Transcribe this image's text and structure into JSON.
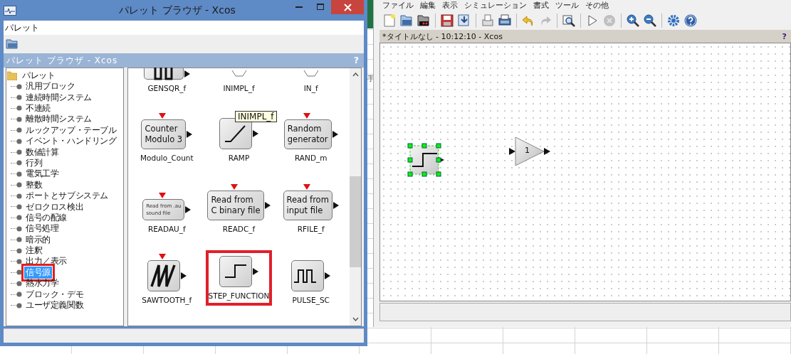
{
  "background_sheet": {
    "cell_text": "手"
  },
  "palette_window": {
    "title": "パレット ブラウザ - Xcos",
    "menu": [
      "パレット"
    ],
    "panel_title": "パレット ブラウザ - Xcos",
    "panel_help": "?",
    "tree": {
      "label": "パレット",
      "children": [
        {
          "label": "汎用ブロック",
          "selected": false
        },
        {
          "label": "連続時間システム",
          "selected": false
        },
        {
          "label": "不連続",
          "selected": false
        },
        {
          "label": "離散時間システム",
          "selected": false
        },
        {
          "label": "ルックアップ・テーブル",
          "selected": false
        },
        {
          "label": "イベント・ハンドリング",
          "selected": false
        },
        {
          "label": "数値計算",
          "selected": false
        },
        {
          "label": "行列",
          "selected": false
        },
        {
          "label": "電気工学",
          "selected": false
        },
        {
          "label": "整数",
          "selected": false
        },
        {
          "label": "ポートとサブシステム",
          "selected": false
        },
        {
          "label": "ゼロクロス検出",
          "selected": false
        },
        {
          "label": "信号の配線",
          "selected": false
        },
        {
          "label": "信号処理",
          "selected": false
        },
        {
          "label": "暗示的",
          "selected": false
        },
        {
          "label": "注釈",
          "selected": false
        },
        {
          "label": "出力／表示",
          "selected": false
        },
        {
          "label": "信号源",
          "selected": true
        },
        {
          "label": "熱水力学",
          "selected": false
        },
        {
          "label": "ブロック・デモ",
          "selected": false
        },
        {
          "label": "ユーザ定義関数",
          "selected": false
        }
      ]
    },
    "blocks": [
      {
        "name": "GENSQR_f",
        "kind": "squarewave",
        "event_input": false,
        "selected": false,
        "cut": true
      },
      {
        "name": "INIMPL_f",
        "kind": "port",
        "event_input": false,
        "selected": false,
        "cut": true
      },
      {
        "name": "IN_f",
        "kind": "port",
        "event_input": false,
        "selected": false,
        "cut": true
      },
      {
        "name": "Modulo_Count",
        "kind": "text",
        "face": "Counter\nModulo 3",
        "event_input": true,
        "selected": false,
        "cut": false
      },
      {
        "name": "RAMP",
        "kind": "ramp",
        "event_input": false,
        "selected": false,
        "cut": false,
        "tooltip": "INIMPL_f"
      },
      {
        "name": "RAND_m",
        "kind": "text",
        "face": "Random\ngenerator",
        "event_input": true,
        "selected": false,
        "cut": false
      },
      {
        "name": "READAU_f",
        "kind": "small_text",
        "face": "Read from .au\nsound file",
        "event_input": true,
        "selected": false,
        "cut": false
      },
      {
        "name": "READC_f",
        "kind": "text",
        "face": "Read from\nC binary file",
        "event_input": true,
        "selected": false,
        "cut": false
      },
      {
        "name": "RFILE_f",
        "kind": "text",
        "face": "Read from\ninput file",
        "event_input": true,
        "selected": false,
        "cut": false
      },
      {
        "name": "SAWTOOTH_f",
        "kind": "sawtooth",
        "event_input": true,
        "selected": false,
        "cut": false
      },
      {
        "name": "STEP_FUNCTION",
        "kind": "step",
        "event_input": false,
        "selected": true,
        "cut": false
      },
      {
        "name": "PULSE_SC",
        "kind": "pulse",
        "event_input": false,
        "selected": false,
        "cut": false
      }
    ]
  },
  "diagram_window": {
    "menu": [
      "ファイル",
      "編集",
      "表示",
      "シミュレーション",
      "書式",
      "ツール",
      "その他"
    ],
    "toolbar": [
      {
        "kind": "new",
        "disabled": false
      },
      {
        "kind": "open",
        "disabled": false
      },
      {
        "kind": "open-folder",
        "disabled": false
      },
      {
        "kind": "save",
        "disabled": false
      },
      {
        "kind": "save-as",
        "disabled": false
      },
      {
        "kind": "export",
        "disabled": false
      },
      {
        "kind": "print",
        "disabled": false
      },
      {
        "kind": "undo",
        "disabled": false
      },
      {
        "kind": "redo",
        "disabled": true
      },
      {
        "kind": "fit",
        "disabled": false
      },
      {
        "kind": "start",
        "disabled": false
      },
      {
        "kind": "stop",
        "disabled": true
      },
      {
        "kind": "zoom-in",
        "disabled": false
      },
      {
        "kind": "zoom-out",
        "disabled": false
      },
      {
        "kind": "settings",
        "disabled": false
      },
      {
        "kind": "help",
        "disabled": false
      }
    ],
    "title": "*タイトルなし - 10:12:10 - Xcos",
    "help": "?",
    "canvas_blocks": [
      {
        "kind": "step",
        "selected": true
      },
      {
        "kind": "gain",
        "label": "1",
        "selected": false
      }
    ]
  }
}
